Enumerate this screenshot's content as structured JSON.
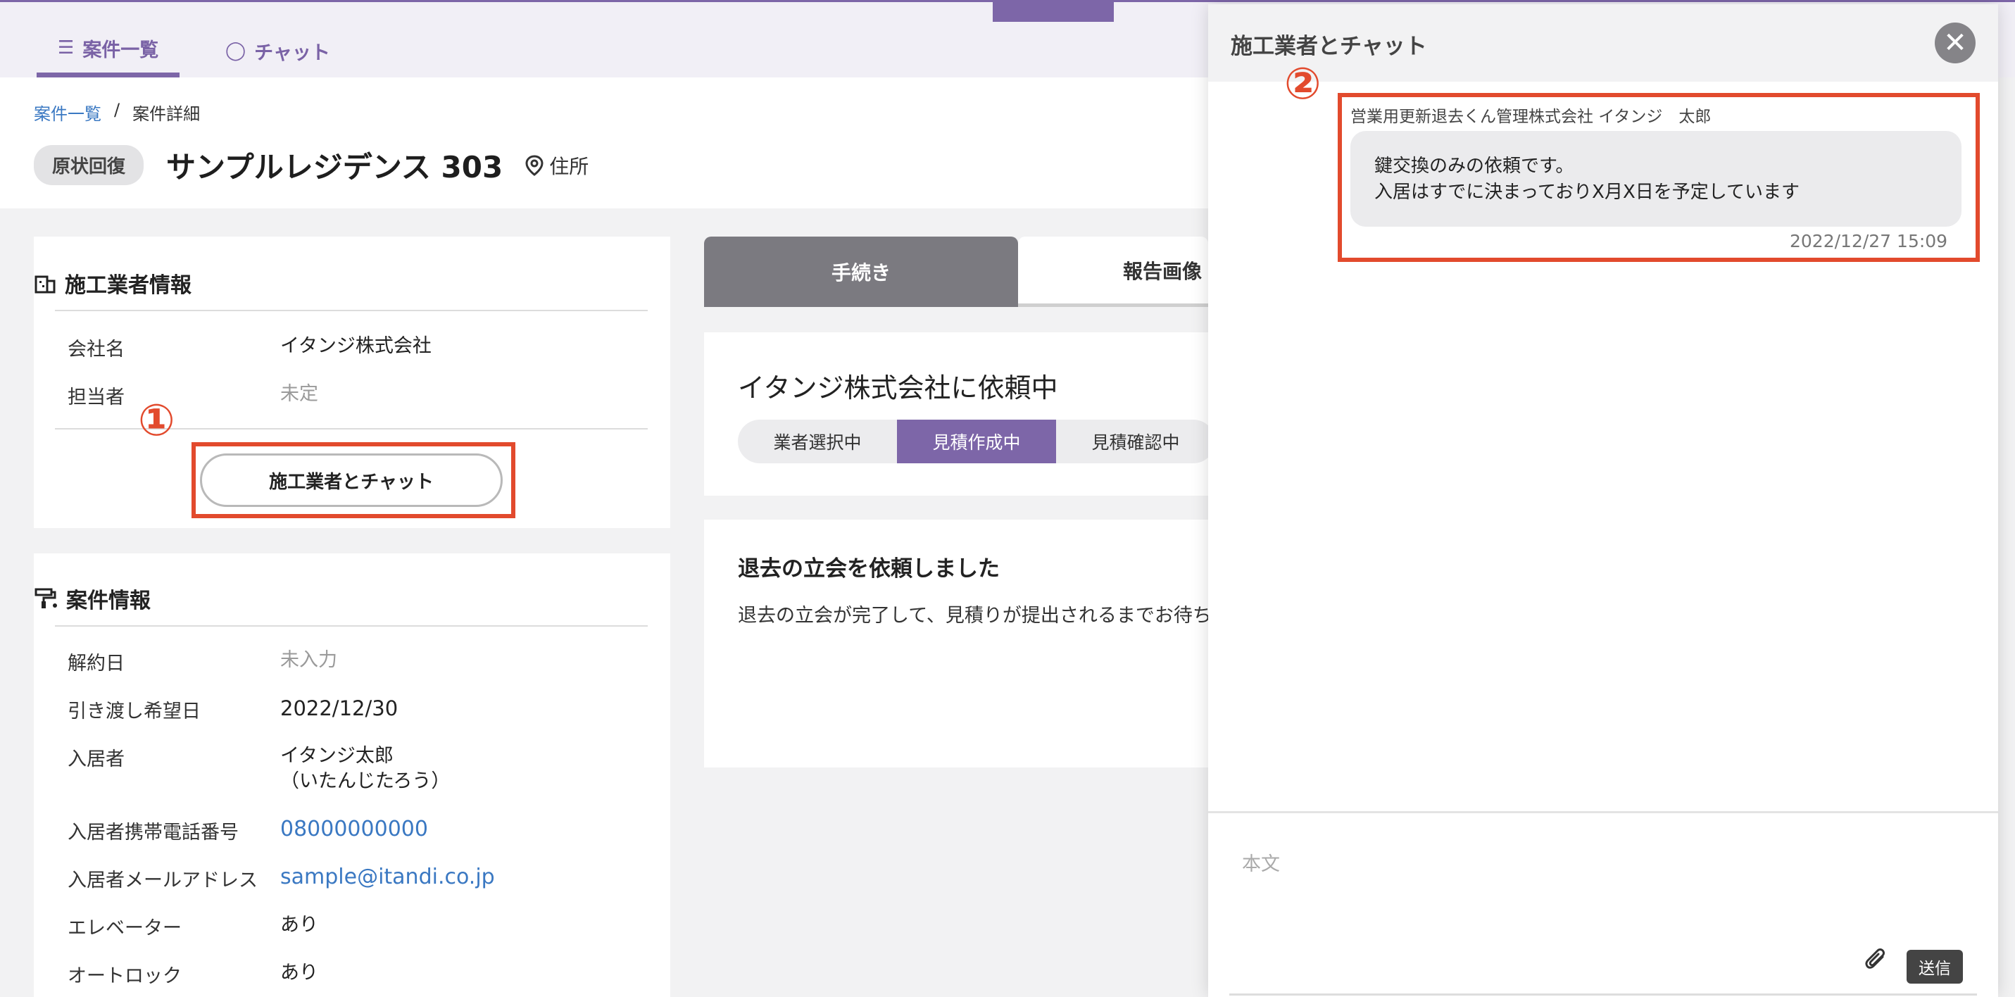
{
  "nav": {
    "tabs": [
      {
        "label": "案件一覧",
        "icon": "list-icon"
      },
      {
        "label": "チャット",
        "icon": "chat-bubble-icon"
      }
    ]
  },
  "breadcrumb": {
    "items": [
      "案件一覧",
      "案件詳細"
    ],
    "separator": "/"
  },
  "header": {
    "badge": "原状回復",
    "title": "サンプルレジデンス 303",
    "address_label": "住所"
  },
  "contractor": {
    "title": "施工業者情報",
    "fields": [
      {
        "key": "会社名",
        "value": "イタンジ株式会社"
      },
      {
        "key": "担当者",
        "value": "未定"
      }
    ],
    "chat_button": "施工業者とチャット"
  },
  "case_info": {
    "title": "案件情報",
    "fields": [
      {
        "key": "解約日",
        "value": "未入力"
      },
      {
        "key": "引き渡し希望日",
        "value": "2022/12/30"
      },
      {
        "key": "入居者",
        "value": "イタンジ太郎",
        "value2": "（いたんじたろう）"
      },
      {
        "key": "入居者携帯電話番号",
        "value": "08000000000"
      },
      {
        "key": "入居者メールアドレス",
        "value": "sample@itandi.co.jp"
      },
      {
        "key": "エレベーター",
        "value": "あり"
      },
      {
        "key": "オートロック",
        "value": "あり"
      }
    ]
  },
  "annotations": {
    "one": "①",
    "two": "②",
    "color": "#e24a2d"
  },
  "main": {
    "tabs": [
      "手続き",
      "報告画像"
    ],
    "status_title": "イタンジ株式会社に依頼中",
    "steps": [
      "業者選択中",
      "見積作成中",
      "見積確認中"
    ],
    "active_step": 1,
    "note_title": "退去の立会を依頼しました",
    "note_body": "退去の立会が完了して、見積りが提出されるまでお待ちください"
  },
  "chat": {
    "title": "施工業者とチャット",
    "message": {
      "sender": "営業用更新退去くん管理株式会社 イタンジ　太郎",
      "lines": [
        "鍵交換のみの依頼です。",
        "入居はすでに決まっておりX月X日を予定しています"
      ],
      "time": "2022/12/27 15:09"
    },
    "input_placeholder": "本文",
    "send_label": "送信"
  },
  "colors": {
    "accent": "#7d66a8",
    "link": "#3a78c2",
    "annotation": "#e24a2d"
  }
}
